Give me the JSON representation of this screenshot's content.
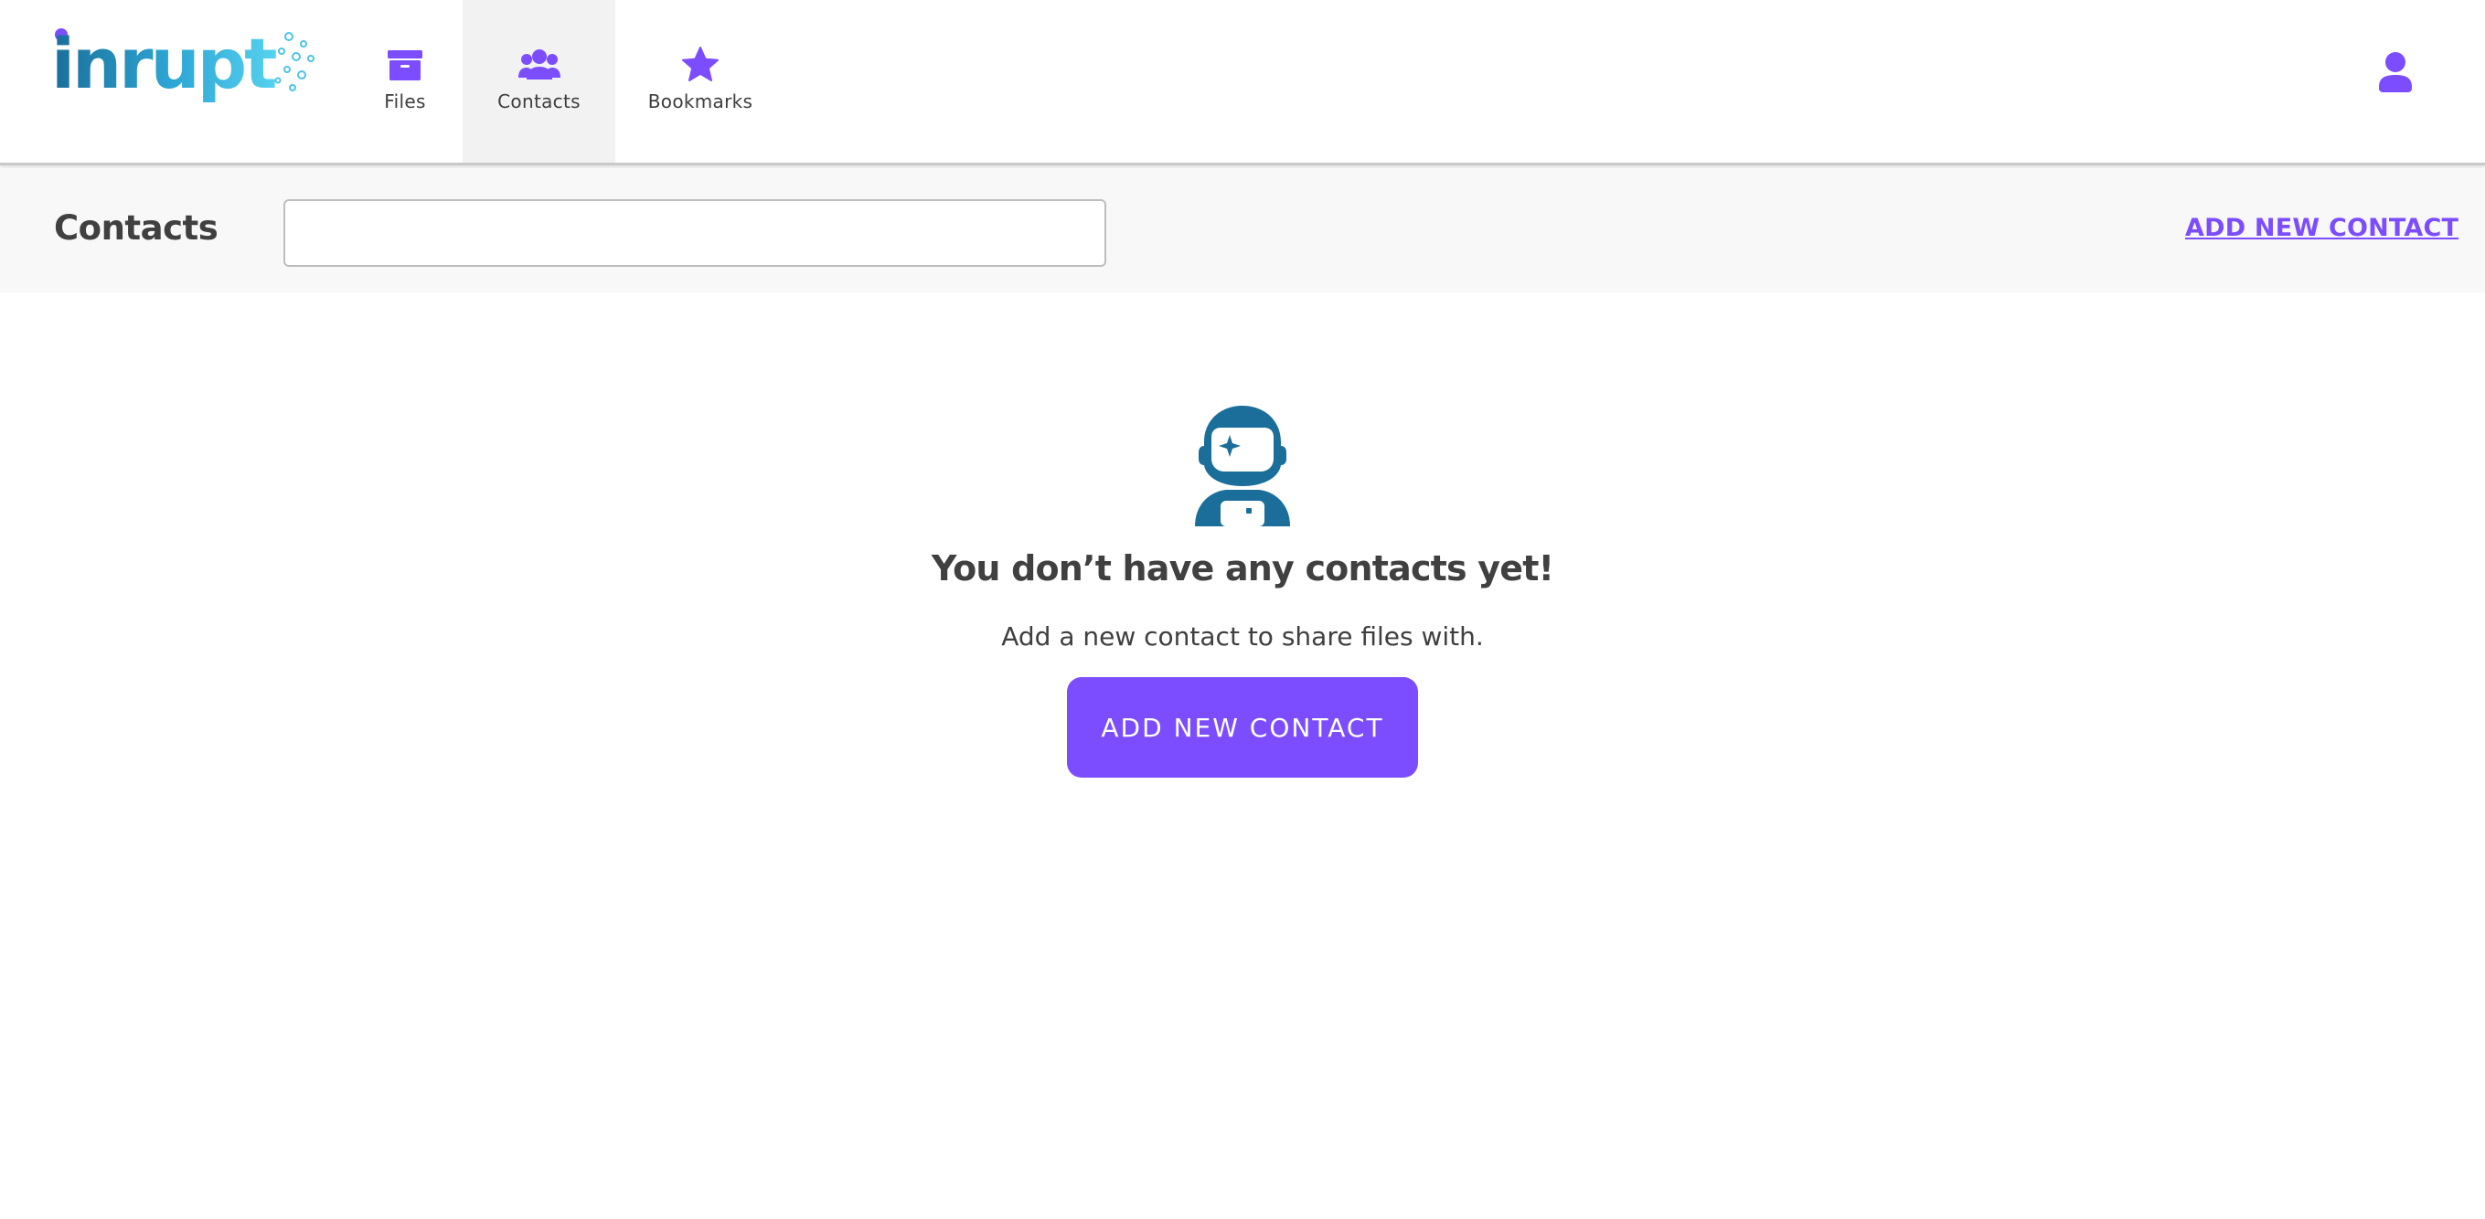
{
  "brand": {
    "logo_text": "inrupt",
    "primary_color": "#7c4dff",
    "logo_dark": "#1a6e99",
    "logo_light": "#4fc3e8"
  },
  "nav": {
    "items": [
      {
        "label": "Files",
        "icon": "archive-box-icon",
        "active": false
      },
      {
        "label": "Contacts",
        "icon": "users-icon",
        "active": true
      },
      {
        "label": "Bookmarks",
        "icon": "star-icon",
        "active": false
      }
    ],
    "profile_icon": "user-icon"
  },
  "subheader": {
    "title": "Contacts",
    "search": {
      "value": "",
      "placeholder": ""
    },
    "add_link": "ADD NEW CONTACT"
  },
  "empty_state": {
    "icon": "astronaut-icon",
    "title": "You don’t have any contacts yet!",
    "text": "Add a new contact to share files with.",
    "button_label": "ADD NEW CONTACT"
  }
}
